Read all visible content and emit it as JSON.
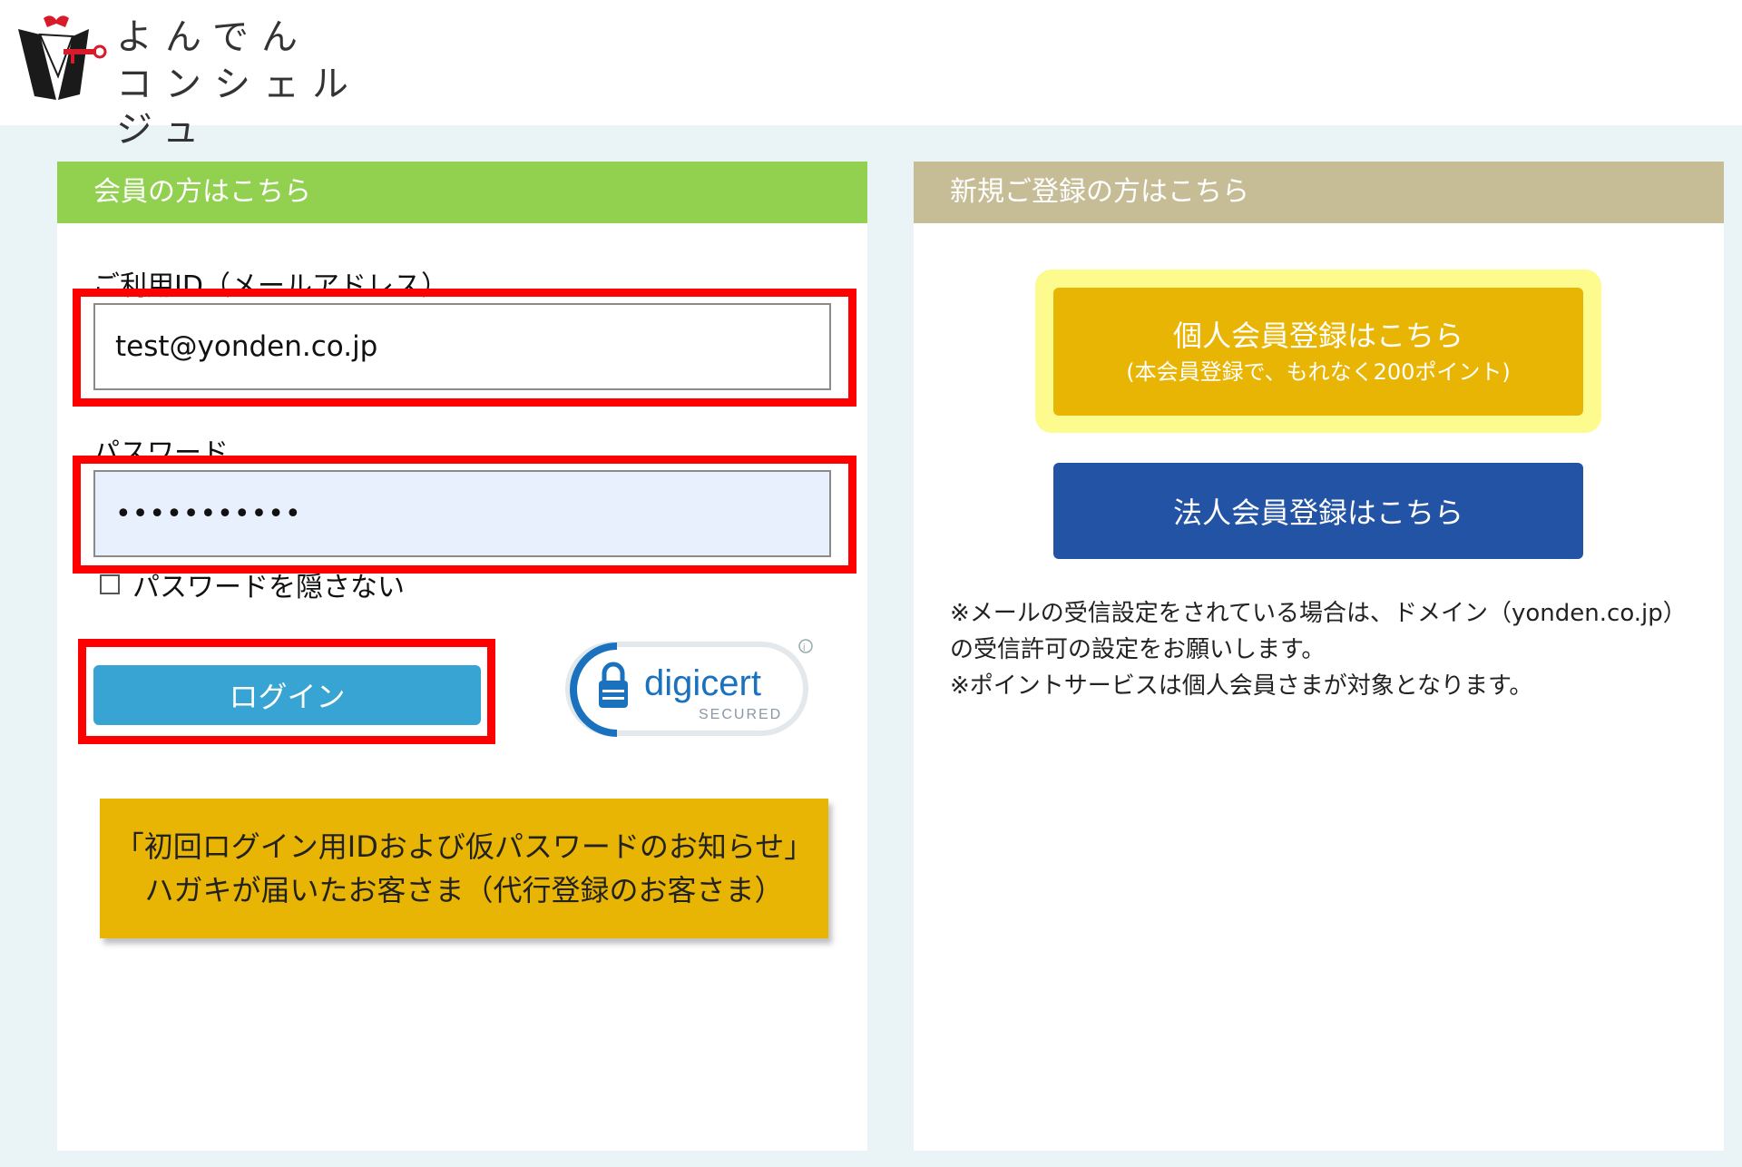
{
  "brand": {
    "line1": "よんでん",
    "line2": "コンシェルジュ"
  },
  "member": {
    "header": "会員の方はこちら",
    "id_label": "ご利用ID（メールアドレス）",
    "id_value": "test@yonden.co.jp",
    "password_label": "パスワード",
    "password_value": "•••••••••••",
    "show_password_label": "パスワードを隠さない",
    "login_label": "ログイン",
    "notice_line1": "「初回ログイン用IDおよび仮パスワードのお知らせ」",
    "notice_line2": "ハガキが届いたお客さま（代行登録のお客さま）"
  },
  "badge": {
    "brand": "digicert",
    "sub": "SECURED",
    "info": "i"
  },
  "register": {
    "header": "新規ご登録の方はこちら",
    "personal_label": "個人会員登録はこちら",
    "personal_sub": "(本会員登録で、もれなく200ポイント)",
    "corporate_label": "法人会員登録はこちら",
    "note1": "※メールの受信設定をされている場合は、ドメイン（yonden.co.jp）",
    "note2": "の受信許可の設定をお願いします。",
    "note3": "※ポイントサービスは個人会員さまが対象となります。"
  },
  "colors": {
    "green_header": "#92d050",
    "tan_header": "#c6bd97",
    "login_blue": "#37a4d3",
    "yellow": "#e9b505",
    "corporate_blue": "#2353a4",
    "highlight_red": "#ff0000"
  }
}
